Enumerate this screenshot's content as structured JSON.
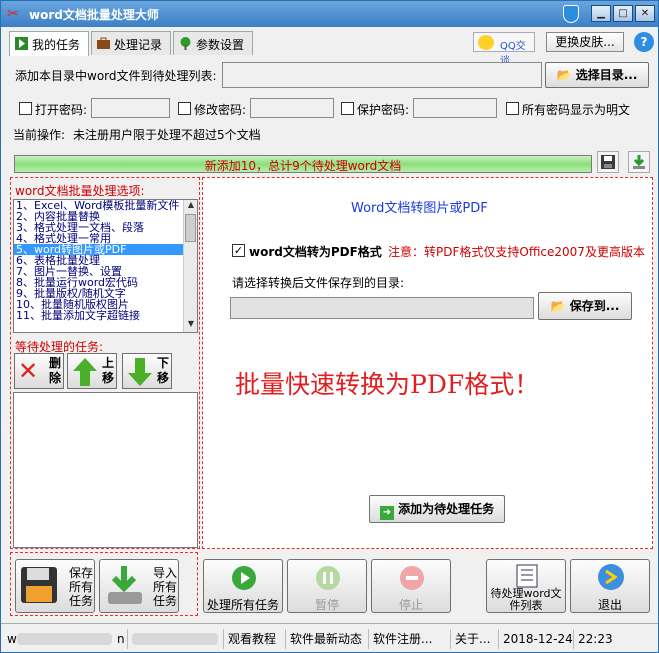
{
  "window": {
    "title": "word文档批量处理大师"
  },
  "tabs": [
    {
      "label": "我的任务"
    },
    {
      "label": "处理记录"
    },
    {
      "label": "参数设置"
    }
  ],
  "header": {
    "qq_label": "QQ交谈",
    "skin_label": "更换皮肤...",
    "help_label": "?"
  },
  "top": {
    "add_dir_label": "添加本目录中word文件到待处理列表:",
    "choose_dir_button": "选择目录...",
    "open_pwd_label": "打开密码:",
    "edit_pwd_label": "修改密码:",
    "protect_pwd_label": "保护密码:",
    "show_plain_label": "所有密码显示为明文",
    "current_op_label": "当前操作:",
    "current_op_text": "未注册用户限于处理不超过5个文档",
    "progress_text": "新添加10，总计9个待处理word文档",
    "progress_fraction": 1.0
  },
  "left": {
    "options_title": "word文档批量处理选项:",
    "options": [
      "1、Excel、Word模板批量新文件",
      "2、内容批量替换",
      "3、格式处理一文档、段落",
      "4、格式处理一常用",
      "5、word转图片或PDF",
      "6、表格批量处理",
      "7、图片一替换、设置",
      "8、批量运行word宏代码",
      "9、批量版权/随机文字",
      "10、批量随机版权图片",
      "11、批量添加文字超链接"
    ],
    "selected_index": 4,
    "pending_title": "等待处理的任务:",
    "delete_button": "删除",
    "up_button": "上移",
    "down_button": "下移"
  },
  "right": {
    "heading": "Word文档转图片或PDF",
    "to_pdf_label": "word文档转为PDF格式",
    "to_pdf_checked": true,
    "note": "注意：转PDF格式仅支持Office2007及更高版本",
    "save_dir_label": "请选择转换后文件保存到的目录:",
    "save_to_button": "保存到...",
    "promo": "批量快速转换为PDF格式！",
    "add_task_button": "添加为待处理任务"
  },
  "bottom": {
    "save_all_button": "保存所有任务",
    "import_all_button": "导入所有任务",
    "process_all_button": "处理所有任务",
    "pause_button": "暂停",
    "stop_button": "停止",
    "list_button": "待处理word文件列表",
    "exit_button": "退出"
  },
  "status": {
    "item1": "w",
    "item2": "n",
    "tutorial": "观看教程",
    "news": "软件最新动态",
    "register": "软件注册...",
    "about": "关于...",
    "date": "2018-12-24",
    "time": "22:23"
  },
  "colors": {
    "accent": "#3b7fc6",
    "red": "#e02020",
    "link": "#00007a",
    "green": "#3aa83a"
  }
}
